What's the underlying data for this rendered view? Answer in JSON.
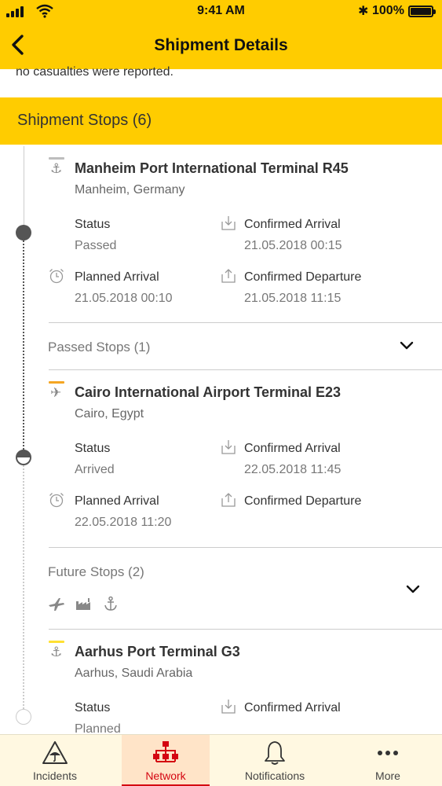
{
  "status_bar": {
    "time": "9:41 AM",
    "battery": "100%"
  },
  "header": {
    "title": "Shipment Details"
  },
  "content_snippet": "no casualties were reported.",
  "section": {
    "title": "Shipment Stops (6)"
  },
  "stops": [
    {
      "name": "Manheim Port International Terminal R45",
      "location": "Manheim, Germany",
      "icon": "anchor-icon",
      "status_label": "Status",
      "status_value": "Passed",
      "confirmed_arrival_label": "Confirmed Arrival",
      "confirmed_arrival_value": "21.05.2018 00:15",
      "planned_arrival_label": "Planned Arrival",
      "planned_arrival_value": "21.05.2018 00:10",
      "confirmed_departure_label": "Confirmed Departure",
      "confirmed_departure_value": "21.05.2018 11:15"
    },
    {
      "name": "Cairo International Airport Terminal E23",
      "location": "Cairo, Egypt",
      "icon": "plane-icon",
      "status_label": "Status",
      "status_value": "Arrived",
      "confirmed_arrival_label": "Confirmed Arrival",
      "confirmed_arrival_value": "22.05.2018 11:45",
      "planned_arrival_label": "Planned Arrival",
      "planned_arrival_value": "22.05.2018 11:20",
      "confirmed_departure_label": "Confirmed Departure",
      "confirmed_departure_value": ""
    },
    {
      "name": "Aarhus Port Terminal G3",
      "location": "Aarhus, Saudi Arabia",
      "icon": "anchor-icon",
      "status_label": "Status",
      "status_value": "Planned",
      "confirmed_arrival_label": "Confirmed Arrival",
      "confirmed_arrival_value": ""
    }
  ],
  "groups": {
    "passed": {
      "label": "Passed Stops (1)"
    },
    "future": {
      "label": "Future Stops (2)",
      "icons": [
        "plane-icon",
        "factory-icon",
        "anchor-icon"
      ]
    }
  },
  "colors": {
    "brand_yellow": "#FFCC00",
    "brand_red": "#D40511",
    "bar_passed": "#BDBDBD",
    "bar_current": "#F5A623",
    "bar_future": "#FFE033"
  },
  "tabs": [
    {
      "label": "Incidents",
      "icon": "warning-umbrella-icon"
    },
    {
      "label": "Network",
      "icon": "network-icon",
      "active": true
    },
    {
      "label": "Notifications",
      "icon": "bell-icon"
    },
    {
      "label": "More",
      "icon": "more-dots-icon"
    }
  ]
}
